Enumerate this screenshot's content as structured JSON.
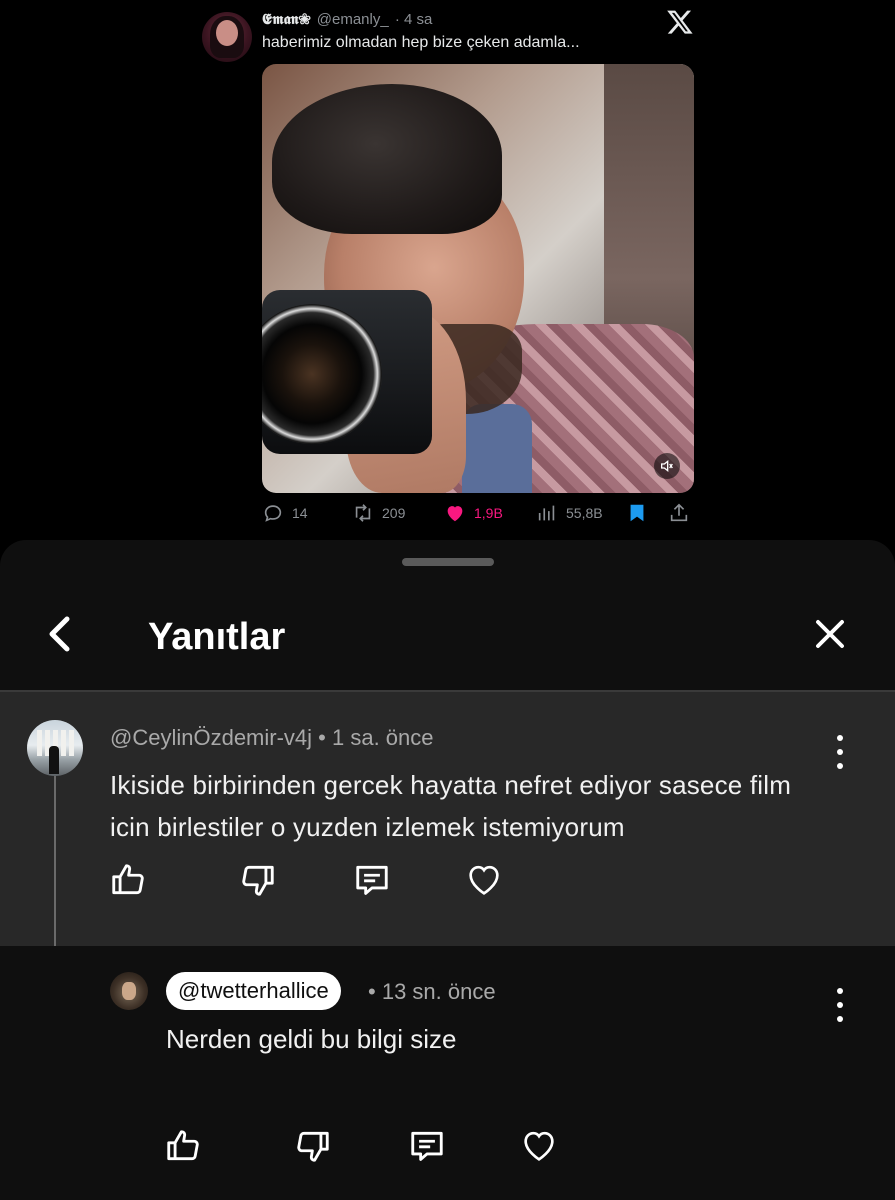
{
  "tweet": {
    "author_name": "𝕰𝖒𝖆𝖓❀",
    "handle": "@emanly_",
    "time": "· 4 sa",
    "text": "haberimiz olmadan hep bize çeken adamla...",
    "stats": {
      "replies": "14",
      "retweets": "209",
      "likes": "1,9B",
      "views": "55,8B"
    },
    "colors": {
      "like": "#f91880",
      "bookmark": "#1d9bf0",
      "muted": "#8b8f94"
    }
  },
  "sheet": {
    "title": "Yanıtlar"
  },
  "comments": [
    {
      "author": "@CeylinÖzdemir-v4j",
      "time": "1 sa. önce",
      "text": "Ikiside birbirinden gercek hayatta nefret ediyor sasece film icin birlestiler o yuzden izlemek istemiyorum"
    }
  ],
  "reply": {
    "mention": "@twetterhallice",
    "time": "13 sn. önce",
    "text": "Nerden geldi bu bilgi size"
  },
  "icons": [
    "x-logo-icon",
    "reply-icon",
    "retweet-icon",
    "heart-icon",
    "views-icon",
    "bookmark-icon",
    "share-icon",
    "volume-icon",
    "back-chevron-icon",
    "close-icon",
    "more-vertical-icon",
    "thumbs-up-icon",
    "thumbs-down-icon",
    "comment-icon"
  ]
}
